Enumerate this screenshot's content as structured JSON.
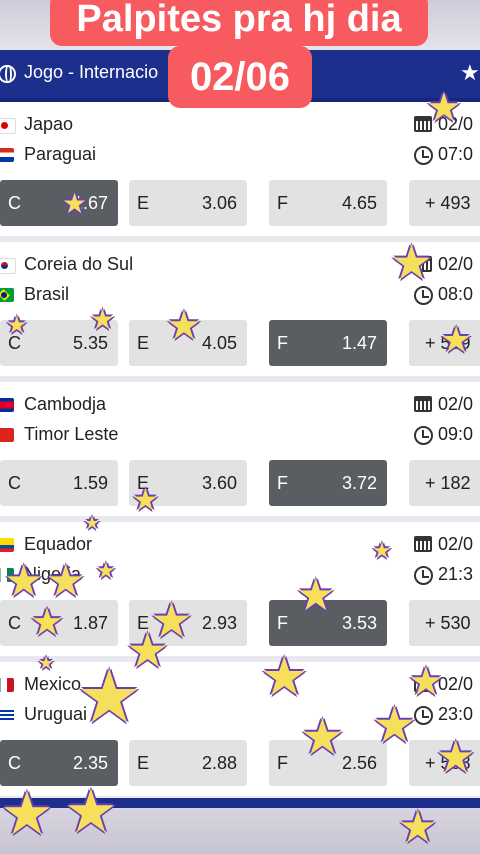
{
  "overlay": {
    "title": "Palpites pra hj dia",
    "date": "02/06"
  },
  "header": {
    "label": "Jogo - Internacio",
    "icon": "globe-icon",
    "star_icon": "star-icon"
  },
  "colors": {
    "header_bg": "#1d2f8c",
    "banner_bg": "#f75a5f",
    "selected_odd": "#5a5e63",
    "odd_bg": "#e2e2e2",
    "star_fill": "#f6df5b",
    "star_outline": "#6a3fb3"
  },
  "matches": [
    {
      "home": "Japao",
      "away": "Paraguai",
      "date": "02/0",
      "time": "07:0",
      "odds": [
        {
          "k": "C",
          "v": "1.67"
        },
        {
          "k": "E",
          "v": "3.06"
        },
        {
          "k": "F",
          "v": "4.65"
        }
      ],
      "more": "+ 493",
      "selected": 0
    },
    {
      "home": "Coreia do Sul",
      "away": "Brasil",
      "date": "02/0",
      "time": "08:0",
      "odds": [
        {
          "k": "C",
          "v": "5.35"
        },
        {
          "k": "E",
          "v": "4.05"
        },
        {
          "k": "F",
          "v": "1.47"
        }
      ],
      "more": "+ 559",
      "selected": 2
    },
    {
      "home": "Cambodja",
      "away": "Timor Leste",
      "date": "02/0",
      "time": "09:0",
      "odds": [
        {
          "k": "C",
          "v": "1.59"
        },
        {
          "k": "E",
          "v": "3.60"
        },
        {
          "k": "F",
          "v": "3.72"
        }
      ],
      "more": "+ 182",
      "selected": 2
    },
    {
      "home": "Equador",
      "away": "Nigeria",
      "date": "02/0",
      "time": "21:3",
      "odds": [
        {
          "k": "C",
          "v": "1.87"
        },
        {
          "k": "E",
          "v": "2.93"
        },
        {
          "k": "F",
          "v": "3.53"
        }
      ],
      "more": "+ 530",
      "selected": 2
    },
    {
      "home": "Mexico",
      "away": "Uruguai",
      "date": "02/0",
      "time": "23:0",
      "odds": [
        {
          "k": "C",
          "v": "2.35"
        },
        {
          "k": "E",
          "v": "2.88"
        },
        {
          "k": "F",
          "v": "2.56"
        }
      ],
      "more": "+ 568",
      "selected": 0
    }
  ]
}
